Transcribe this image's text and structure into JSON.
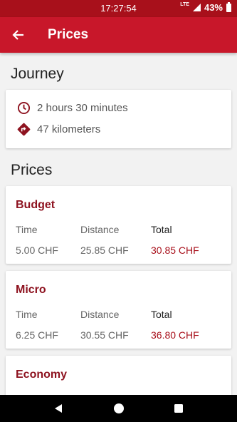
{
  "status_bar": {
    "time": "17:27:54",
    "network": "LTE",
    "battery": "43%"
  },
  "app_bar": {
    "title": "Prices",
    "back_icon": "arrow-left-icon"
  },
  "journey": {
    "heading": "Journey",
    "duration": "2 hours 30 minutes",
    "distance": "47 kilometers",
    "duration_icon": "clock-icon",
    "distance_icon": "directions-icon"
  },
  "prices": {
    "heading": "Prices",
    "columns": {
      "time": "Time",
      "distance": "Distance",
      "total": "Total"
    },
    "items": [
      {
        "name": "Budget",
        "time": "5.00 CHF",
        "distance": "25.85 CHF",
        "total": "30.85 CHF"
      },
      {
        "name": "Micro",
        "time": "6.25 CHF",
        "distance": "30.55 CHF",
        "total": "36.80 CHF"
      },
      {
        "name": "Economy",
        "time": "",
        "distance": "",
        "total": ""
      }
    ]
  },
  "colors": {
    "primary": "#c8172a",
    "primary_dark": "#a8101b",
    "accent_text": "#8e1320"
  },
  "nav_bar": {
    "back_icon": "nav-back-icon",
    "home_icon": "nav-home-icon",
    "recents_icon": "nav-recents-icon"
  }
}
